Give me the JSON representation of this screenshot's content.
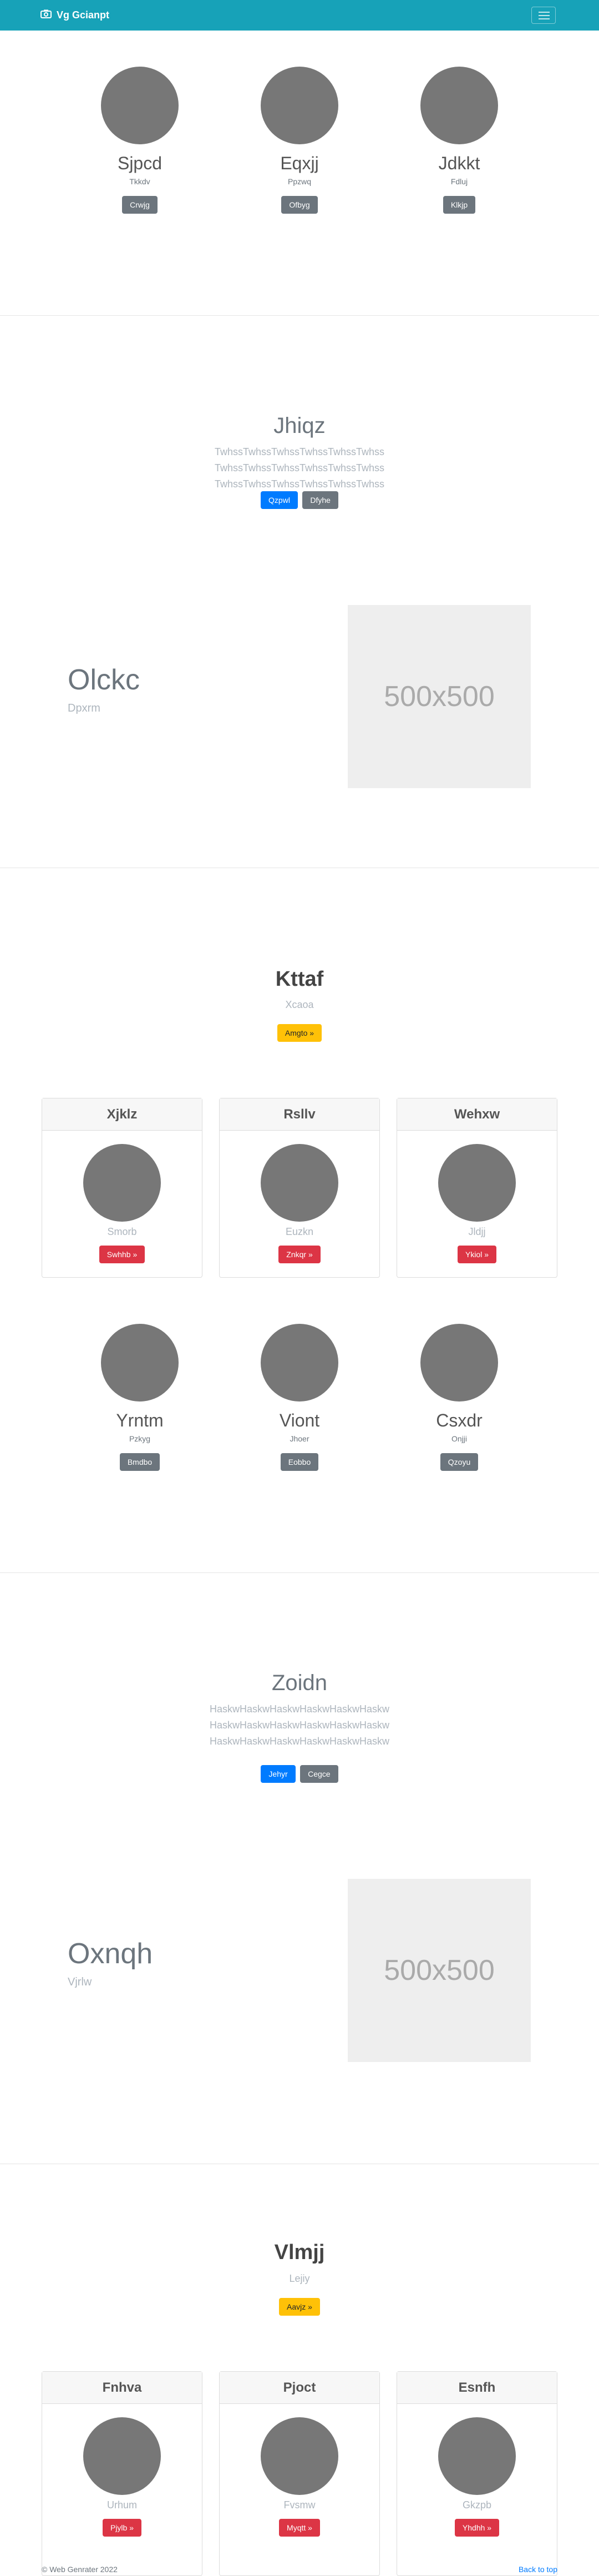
{
  "nav": {
    "brand": "Vg Gcianpt"
  },
  "team1": [
    {
      "name": "Sjpcd",
      "sub": "Tkkdv",
      "btn": "Crwjg"
    },
    {
      "name": "Eqxjj",
      "sub": "Ppzwq",
      "btn": "Ofbyg"
    },
    {
      "name": "Jdkkt",
      "sub": "Fdluj",
      "btn": "Klkjp"
    }
  ],
  "hero1": {
    "title": "Jhiqz",
    "text": "TwhssTwhssTwhssTwhssTwhssTwhss TwhssTwhssTwhssTwhssTwhssTwhss TwhssTwhssTwhssTwhssTwhssTwhss",
    "primary": "Qzpwl",
    "secondary": "Dfyhe"
  },
  "feature1": {
    "heading": "Olckc",
    "sub": "Dpxrm",
    "placeholder": "500x500"
  },
  "callout1": {
    "title": "Kttaf",
    "sub": "Xcaoa",
    "btn": "Amgto »"
  },
  "cards1": [
    {
      "header": "Xjklz",
      "sub": "Smorb",
      "btn": "Swhhb »"
    },
    {
      "header": "Rsllv",
      "sub": "Euzkn",
      "btn": "Znkqr »"
    },
    {
      "header": "Wehxw",
      "sub": "Jldjj",
      "btn": "Ykiol »"
    }
  ],
  "team2": [
    {
      "name": "Yrntm",
      "sub": "Pzkyg",
      "btn": "Bmdbo"
    },
    {
      "name": "Viont",
      "sub": "Jhoer",
      "btn": "Eobbo"
    },
    {
      "name": "Csxdr",
      "sub": "Onjji",
      "btn": "Qzoyu"
    }
  ],
  "hero2": {
    "title": "Zoidn",
    "text": "HaskwHaskwHaskwHaskwHaskwHaskw HaskwHaskwHaskwHaskwHaskwHaskw HaskwHaskwHaskwHaskwHaskwHaskw",
    "primary": "Jehyr",
    "secondary": "Cegce"
  },
  "feature2": {
    "heading": "Oxnqh",
    "sub": "Vjrlw",
    "placeholder": "500x500"
  },
  "callout2": {
    "title": "Vlmjj",
    "sub": "Lejiy",
    "btn": "Aavjz »"
  },
  "cards2": [
    {
      "header": "Fnhva",
      "sub": "Urhum",
      "btn": "Pjylb »"
    },
    {
      "header": "Pjoct",
      "sub": "Fvsmw",
      "btn": "Myqtt »"
    },
    {
      "header": "Esnfh",
      "sub": "Gkzpb",
      "btn": "Yhdhh »"
    }
  ],
  "footer": {
    "copyright": "© Web Genrater 2022",
    "back": "Back to top"
  }
}
